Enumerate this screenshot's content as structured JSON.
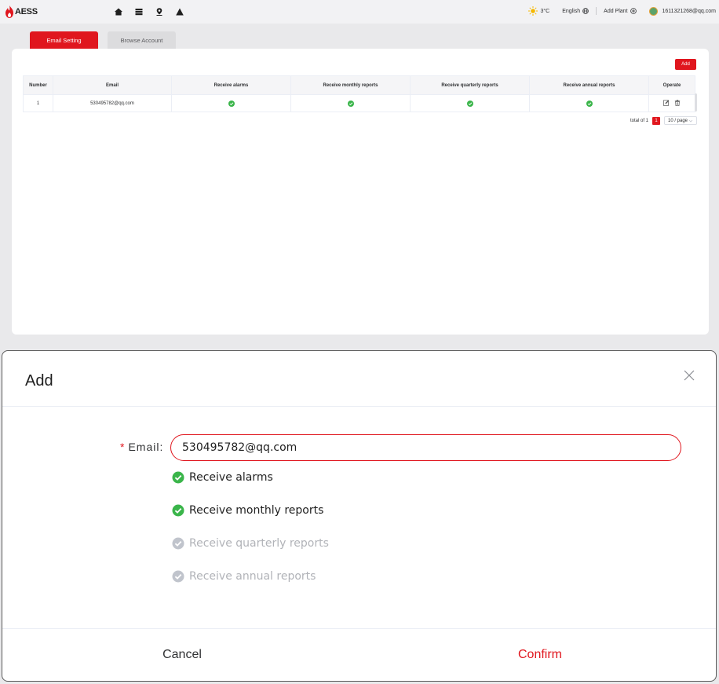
{
  "header": {
    "brand": "AESS",
    "nav_icons": [
      "home-icon",
      "list-icon",
      "map-pin-icon",
      "alert-icon"
    ],
    "weather_temp": "3°C",
    "language_label": "English",
    "add_plant_label": "Add Plant",
    "user_email": "1611321268@qq.com"
  },
  "tabs": [
    {
      "label": "Email Setting",
      "active": true
    },
    {
      "label": "Browse Account",
      "active": false
    }
  ],
  "table": {
    "add_label": "Add",
    "columns": [
      "Number",
      "Email",
      "Receive alarms",
      "Receive monthly reports",
      "Receive quarterly reports",
      "Receive annual reports",
      "Operate"
    ],
    "rows": [
      {
        "number": "1",
        "email": "530495782@qq.com",
        "alarms": true,
        "monthly": true,
        "quarterly": true,
        "annual": true
      }
    ]
  },
  "pagination": {
    "total_label": "total of 1",
    "current_page": "1",
    "page_size": "10 / page"
  },
  "modal": {
    "title": "Add",
    "email_label": "Email:",
    "email_value": "530495782@qq.com",
    "options": [
      {
        "label": "Receive alarms",
        "checked": true
      },
      {
        "label": "Receive monthly reports",
        "checked": true
      },
      {
        "label": "Receive quarterly reports",
        "checked": false
      },
      {
        "label": "Receive annual reports",
        "checked": false
      }
    ],
    "cancel_label": "Cancel",
    "confirm_label": "Confirm"
  },
  "colors": {
    "accent": "#e0161e",
    "check_on": "#3ab54a",
    "check_off": "#c0c4cc"
  }
}
